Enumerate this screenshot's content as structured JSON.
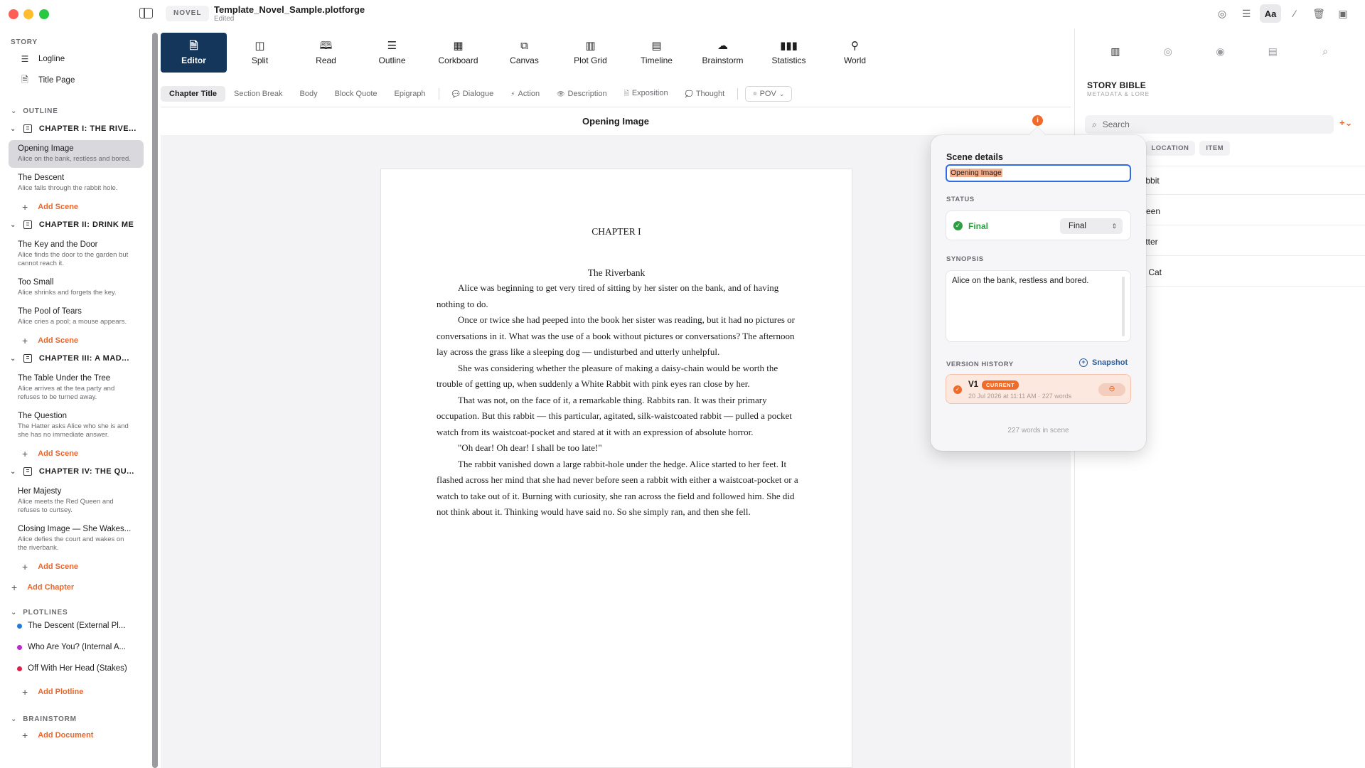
{
  "window": {
    "doc_type": "NOVEL",
    "doc_title": "Template_Novel_Sample.plotforge",
    "doc_status": "Edited",
    "title_tools": [
      {
        "icon": "target-icon",
        "glyph": "◎"
      },
      {
        "icon": "sliders-icon",
        "glyph": "☰"
      },
      {
        "icon": "font-icon",
        "glyph": "Aa",
        "active": true
      },
      {
        "icon": "magic-wand-icon",
        "glyph": "⁄"
      },
      {
        "icon": "trash-icon",
        "glyph": "🗑"
      },
      {
        "icon": "panel-right-icon",
        "glyph": "▣"
      }
    ]
  },
  "sidebar": {
    "story_label": "STORY",
    "logline": "Logline",
    "title_page": "Title Page",
    "outline_label": "OUTLINE",
    "chapters": [
      {
        "title": "CHAPTER I: THE RIVE...",
        "scenes": [
          {
            "title": "Opening Image",
            "synopsis": "Alice on the bank, restless and bored.",
            "selected": true
          },
          {
            "title": "The Descent",
            "synopsis": "Alice falls through the rabbit hole."
          }
        ]
      },
      {
        "title": "CHAPTER II: DRINK ME",
        "scenes": [
          {
            "title": "The Key and the Door",
            "synopsis": "Alice finds the door to the garden but cannot reach it."
          },
          {
            "title": "Too Small",
            "synopsis": "Alice shrinks and forgets the key."
          },
          {
            "title": "The Pool of Tears",
            "synopsis": "Alice cries a pool; a mouse appears."
          }
        ]
      },
      {
        "title": "CHAPTER III: A MAD...",
        "scenes": [
          {
            "title": "The Table Under the Tree",
            "synopsis": "Alice arrives at the tea party and refuses to be turned away."
          },
          {
            "title": "The Question",
            "synopsis": "The Hatter asks Alice who she is and she has no immediate answer."
          }
        ]
      },
      {
        "title": "CHAPTER IV: THE QU...",
        "scenes": [
          {
            "title": "Her Majesty",
            "synopsis": "Alice meets the Red Queen and refuses to curtsey."
          },
          {
            "title": "Closing Image — She Wakes...",
            "synopsis": "Alice defies the court and wakes on the riverbank."
          }
        ]
      }
    ],
    "add_scene": "Add Scene",
    "add_chapter": "Add Chapter",
    "plotlines_label": "PLOTLINES",
    "plotlines": [
      {
        "name": "The Descent (External Pl...",
        "color": "#1f7ae0"
      },
      {
        "name": "Who Are You? (Internal A...",
        "color": "#c026d3"
      },
      {
        "name": "Off With Her Head (Stakes)",
        "color": "#e11d48"
      }
    ],
    "add_plotline": "Add Plotline",
    "brainstorm_label": "BRAINSTORM",
    "add_document": "Add Document"
  },
  "toolbar": {
    "tabs": [
      {
        "label": "Editor",
        "icon": "document-icon",
        "glyph": "🗎",
        "active": true
      },
      {
        "label": "Split",
        "icon": "split-icon",
        "glyph": "◫"
      },
      {
        "label": "Read",
        "icon": "book-icon",
        "glyph": "🕮"
      },
      {
        "label": "Outline",
        "icon": "list-icon",
        "glyph": "☰"
      },
      {
        "label": "Corkboard",
        "icon": "grid-icon",
        "glyph": "▦"
      },
      {
        "label": "Canvas",
        "icon": "canvas-icon",
        "glyph": "⧉"
      },
      {
        "label": "Plot Grid",
        "icon": "plot-grid-icon",
        "glyph": "▥"
      },
      {
        "label": "Timeline",
        "icon": "calendar-icon",
        "glyph": "▤"
      },
      {
        "label": "Brainstorm",
        "icon": "brain-icon",
        "glyph": "☁"
      },
      {
        "label": "Statistics",
        "icon": "bar-chart-icon",
        "glyph": "▮▮▮"
      },
      {
        "label": "World",
        "icon": "globe-icon",
        "glyph": "⚲"
      }
    ],
    "formats": [
      {
        "label": "Chapter Title",
        "active": true
      },
      {
        "label": "Section Break"
      },
      {
        "label": "Body"
      },
      {
        "label": "Block Quote"
      },
      {
        "label": "Epigraph"
      },
      {
        "sep": true
      },
      {
        "label": "Dialogue",
        "glyph": "💬"
      },
      {
        "label": "Action",
        "glyph": "⚡"
      },
      {
        "label": "Description",
        "glyph": "👁"
      },
      {
        "label": "Exposition",
        "glyph": "🗎"
      },
      {
        "label": "Thought",
        "glyph": "💭"
      },
      {
        "sep": true
      },
      {
        "label": "POV",
        "glyph": "⌾",
        "pov": true
      }
    ]
  },
  "editor": {
    "scene_heading": "Opening Image",
    "chapter_heading": "CHAPTER I",
    "chapter_subtitle": "The Riverbank",
    "paragraphs": [
      "Alice was beginning to get very tired of sitting by her sister on the bank, and of having nothing to do.",
      "Once or twice she had peeped into the book her sister was reading, but it had no pictures or conversations in it. What was the use of a book without pictures or conversations? The afternoon lay across the grass like a sleeping dog — undisturbed and utterly unhelpful.",
      "She was considering whether the pleasure of making a daisy-chain would be worth the trouble of getting up, when suddenly a White Rabbit with pink eyes ran close by her.",
      "That was not, on the face of it, a remarkable thing. Rabbits ran. It was their primary occupation. But this rabbit — this particular, agitated, silk-waistcoated rabbit — pulled a pocket watch from its waistcoat-pocket and stared at it with an expression of absolute horror.",
      "\"Oh dear! Oh dear! I shall be too late!\"",
      "The rabbit vanished down a large rabbit-hole under the hedge. Alice started to her feet. It flashed across her mind that she had never before seen a rabbit with either a waistcoat-pocket or a watch to take out of it. Burning with curiosity, she ran across the field and followed him. She did not think about it. Thinking would have said no. So she simply ran, and then she fell."
    ]
  },
  "scene_details": {
    "title": "Scene details",
    "name_value": "Opening Image",
    "status_label": "STATUS",
    "status_value": "Final",
    "status_select": "Final",
    "synopsis_label": "SYNOPSIS",
    "synopsis_value": "Alice on the bank, restless and bored.",
    "version_label": "VERSION HISTORY",
    "snapshot_label": "Snapshot",
    "version_name": "V1",
    "version_badge": "CURRENT",
    "version_meta": "20 Jul 2026 at 11:11 AM · 227 words",
    "word_count": "227 words in scene"
  },
  "story_bible": {
    "title": "STORY BIBLE",
    "subtitle": "METADATA & LORE",
    "search_placeholder": "Search",
    "add_glyph": "+⌄",
    "filters": [
      "",
      "TER",
      "LOCATION",
      "ITEM"
    ],
    "items": [
      "Rabbit",
      "Queen",
      "Hatter",
      "hire Cat"
    ]
  }
}
